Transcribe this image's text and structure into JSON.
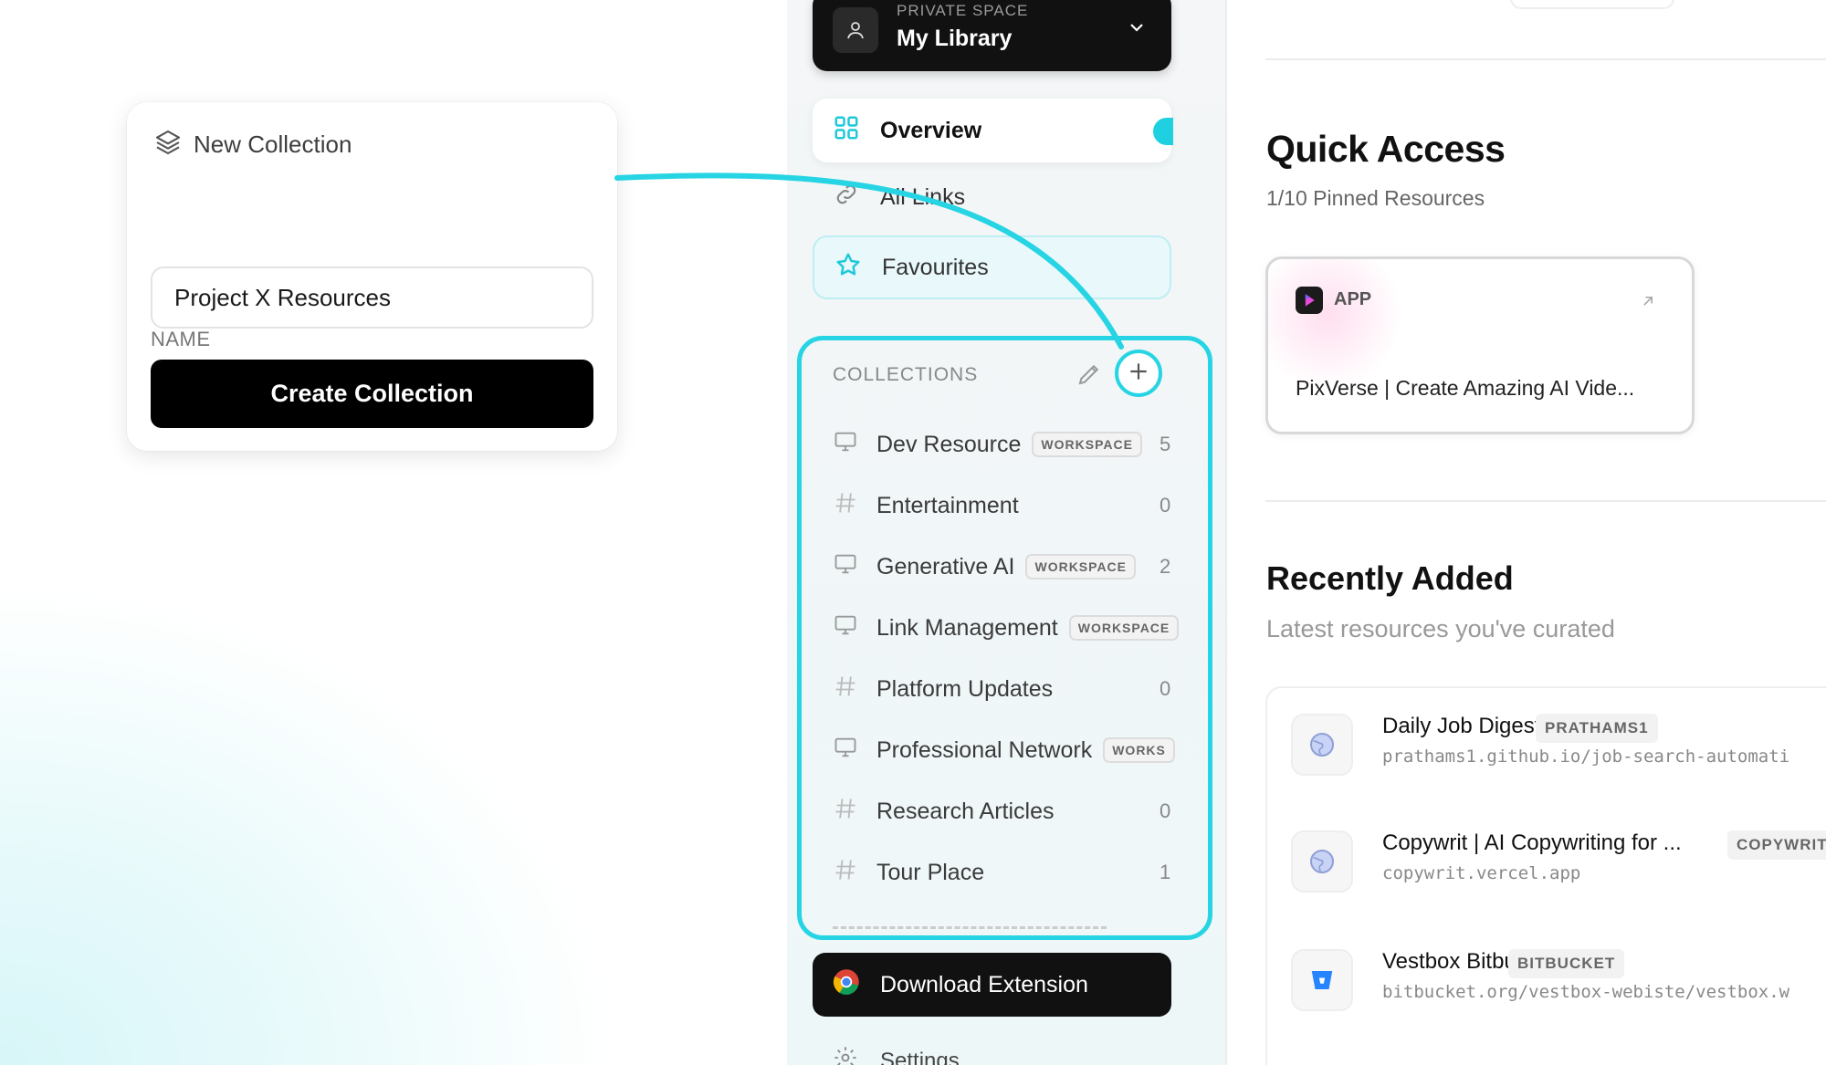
{
  "new_collection": {
    "title": "New Collection",
    "name_label": "NAME",
    "name_value": "Project X Resources",
    "create_label": "Create Collection"
  },
  "sidebar": {
    "space_kicker": "PRIVATE SPACE",
    "space_name": "My Library",
    "nav": [
      {
        "label": "Overview",
        "icon": "grid-icon"
      },
      {
        "label": "All Links",
        "icon": "link-icon"
      },
      {
        "label": "Favourites",
        "icon": "star-icon"
      }
    ],
    "collections_label": "COLLECTIONS",
    "collections": [
      {
        "name": "Dev Resource",
        "badge": "WORKSPACE",
        "count": "5",
        "icon": "monitor-icon"
      },
      {
        "name": "Entertainment",
        "badge": "",
        "count": "0",
        "icon": "hash-icon"
      },
      {
        "name": "Generative AI",
        "badge": "WORKSPACE",
        "count": "2",
        "icon": "monitor-icon"
      },
      {
        "name": "Link Management",
        "badge": "WORKSPACE",
        "count": "",
        "icon": "monitor-icon"
      },
      {
        "name": "Platform Updates",
        "badge": "",
        "count": "0",
        "icon": "hash-icon"
      },
      {
        "name": "Professional Network",
        "badge": "WORKS",
        "count": "",
        "icon": "monitor-icon"
      },
      {
        "name": "Research Articles",
        "badge": "",
        "count": "0",
        "icon": "hash-icon"
      },
      {
        "name": "Tour Place",
        "badge": "",
        "count": "1",
        "icon": "hash-icon"
      }
    ],
    "download_label": "Download Extension",
    "settings_label": "Settings"
  },
  "main": {
    "quick_access_title": "Quick Access",
    "quick_access_sub": "1/10 Pinned Resources",
    "pinned": {
      "kind": "APP",
      "name": "PixVerse | Create Amazing AI Vide..."
    },
    "recent_title": "Recently Added",
    "recent_sub": "Latest resources you've curated",
    "recent": [
      {
        "name": "Daily Job Digest",
        "tag": "PRATHAMS1",
        "url": "prathams1.github.io/job-search-automati",
        "icon": "globe-icon"
      },
      {
        "name": "Copywrit | AI Copywriting for ...",
        "tag": "COPYWRIT",
        "url": "copywrit.vercel.app",
        "icon": "globe-icon"
      },
      {
        "name": "Vestbox Bitbucket",
        "tag": "BITBUCKET",
        "url": "bitbucket.org/vestbox-webiste/vestbox.w",
        "icon": "bitbucket-icon"
      }
    ]
  },
  "colors": {
    "accent": "#26d4e4",
    "dark": "#111111"
  }
}
